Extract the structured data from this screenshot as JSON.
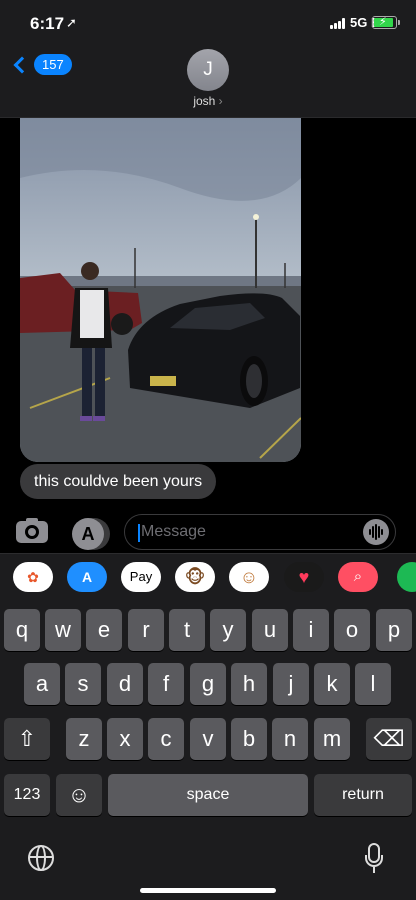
{
  "status": {
    "time": "6:17",
    "network": "5G E"
  },
  "header": {
    "back_count": "157",
    "avatar_initial": "J",
    "contact_name": "josh"
  },
  "messages": [
    {
      "text": "this couldve been yours"
    }
  ],
  "composer": {
    "placeholder": "Message"
  },
  "app_strip": {
    "apple_pay_label": "Pay"
  },
  "keyboard": {
    "row1": [
      "q",
      "w",
      "e",
      "r",
      "t",
      "y",
      "u",
      "i",
      "o",
      "p"
    ],
    "row2": [
      "a",
      "s",
      "d",
      "f",
      "g",
      "h",
      "j",
      "k",
      "l"
    ],
    "row3": [
      "z",
      "x",
      "c",
      "v",
      "b",
      "n",
      "m"
    ],
    "numbers_key": "123",
    "space_key": "space",
    "return_key": "return"
  }
}
